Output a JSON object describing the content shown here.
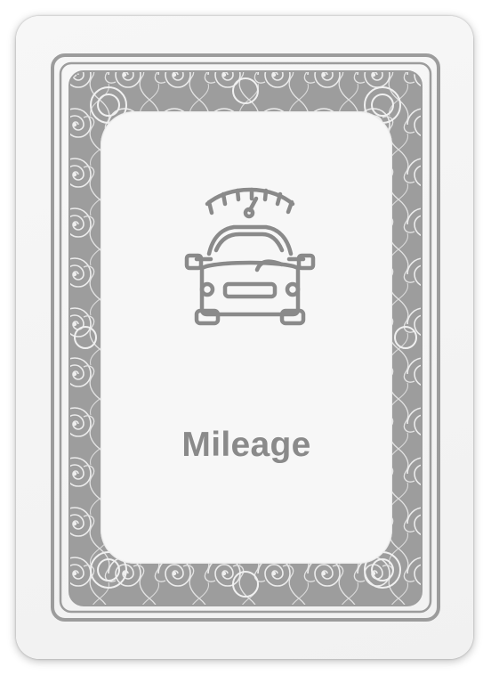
{
  "card": {
    "title": "Mileage",
    "icon": "car-speedometer-icon"
  },
  "colors": {
    "card_background": "#f3f3f3",
    "frame_gray": "#9c9c9c",
    "ornament_light": "#e6e6e6",
    "panel_background": "#f7f7f7",
    "icon_and_text_gray": "#8a8a8a"
  }
}
